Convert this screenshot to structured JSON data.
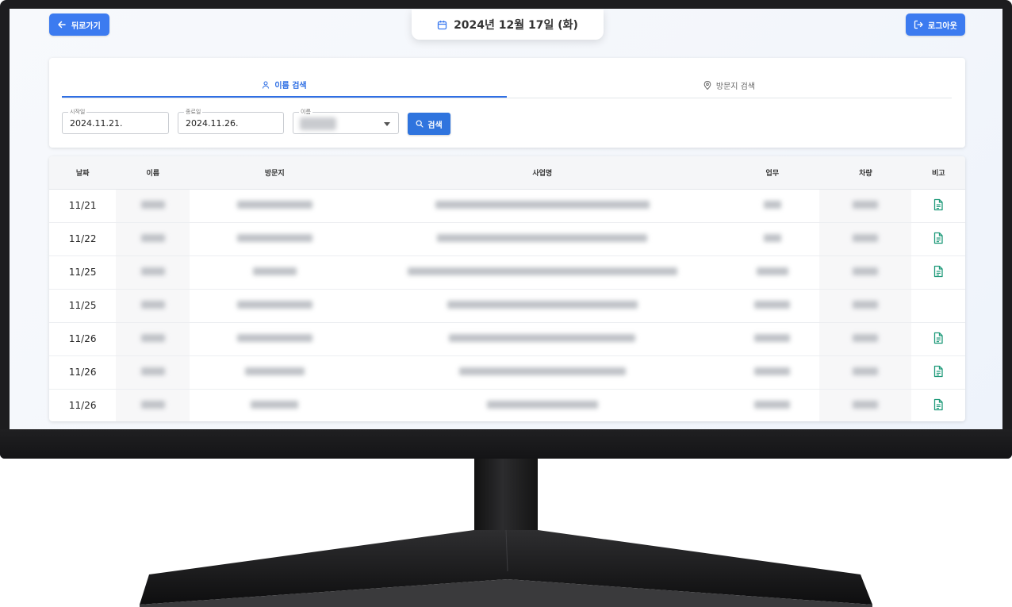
{
  "header": {
    "back_label": "뒤로가기",
    "date_label": "2024년 12월 17일 (화)",
    "logout_label": "로그아웃"
  },
  "tabs": [
    {
      "label": "이름 검색",
      "icon": "user-icon",
      "active": true
    },
    {
      "label": "방문지 검색",
      "icon": "map-pin-icon",
      "active": false
    }
  ],
  "search": {
    "start_label": "시작일",
    "start_value": "2024.11.21.",
    "end_label": "종료일",
    "end_value": "2024.11.26.",
    "name_label": "이름",
    "button_label": "검색"
  },
  "table": {
    "columns": [
      "날짜",
      "이름",
      "방문지",
      "사업명",
      "업무",
      "차량",
      "비고"
    ],
    "rows": [
      {
        "date": "11/21",
        "has_note": true
      },
      {
        "date": "11/22",
        "has_note": true
      },
      {
        "date": "11/25",
        "has_note": true
      },
      {
        "date": "11/25",
        "has_note": false
      },
      {
        "date": "11/26",
        "has_note": true
      },
      {
        "date": "11/26",
        "has_note": true
      },
      {
        "date": "11/26",
        "has_note": true
      }
    ]
  },
  "colors": {
    "accent": "#3c7bf0",
    "note_icon": "#1f9a7a"
  }
}
